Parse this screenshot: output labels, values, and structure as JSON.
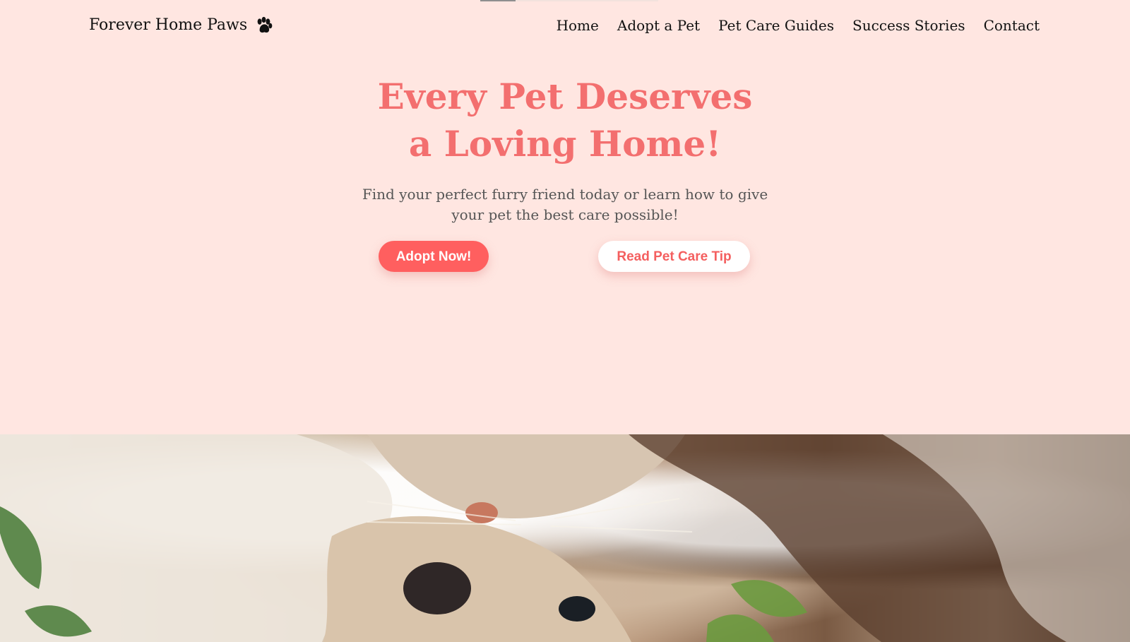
{
  "brand": {
    "name": "Forever Home Paws",
    "icon": "paw-icon",
    "color": "#111111"
  },
  "nav": {
    "items": [
      {
        "label": "Home"
      },
      {
        "label": "Adopt a Pet"
      },
      {
        "label": "Pet Care Guides"
      },
      {
        "label": "Success Stories"
      },
      {
        "label": "Contact"
      }
    ]
  },
  "hero": {
    "title": "Every Pet Deserves a Loving Home!",
    "subtitle": "Find your perfect furry friend today or learn how to give your pet the best care possible!",
    "primary_button": "Adopt Now!",
    "secondary_button": "Read Pet Care Tip",
    "background_color": "#ffe6e1",
    "title_color": "#f36f6f",
    "accent_color": "#ff5f5f"
  },
  "image": {
    "icon": "pet-photo-image"
  }
}
